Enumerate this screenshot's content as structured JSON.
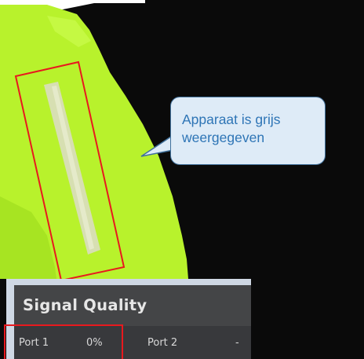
{
  "callout": {
    "line1": "Apparaat is grijs",
    "line2": "weergegeven"
  },
  "signal_panel": {
    "title": "Signal Quality",
    "port1_label": "Port 1",
    "port1_value": "0%",
    "port2_label": "Port 2",
    "port2_value": "-"
  },
  "colors": {
    "device_background": "#0a0a0a",
    "device_body": "#b8f22c",
    "highlight_border": "#e8191e",
    "callout_fill": "#deebf7",
    "callout_text": "#2e75b6"
  }
}
